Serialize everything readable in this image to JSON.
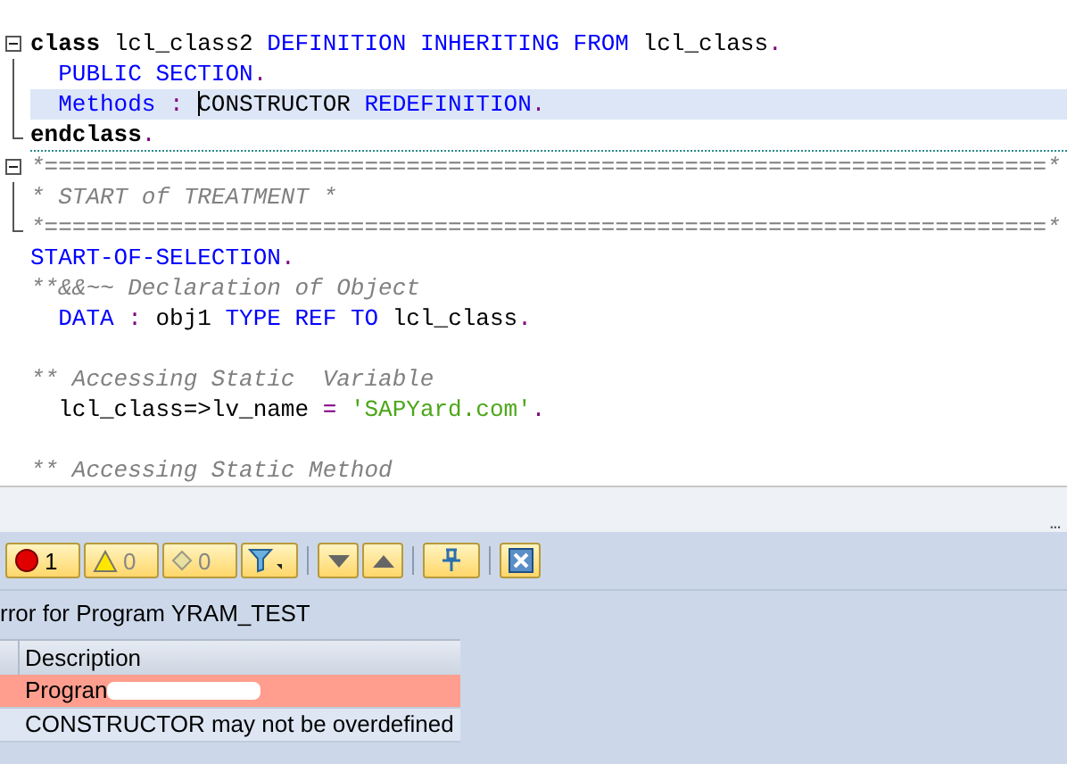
{
  "editor": {
    "lines": [
      {
        "kind": "fold_start",
        "highlighted": false,
        "separator_after": false,
        "tokens": [
          {
            "kind": "bold",
            "text": "class"
          },
          {
            "kind": "ident",
            "text": " lcl_class2 "
          },
          {
            "kind": "keyword",
            "text": "DEFINITION INHERITING FROM"
          },
          {
            "kind": "ident",
            "text": " lcl_class"
          },
          {
            "kind": "punct",
            "text": "."
          }
        ]
      },
      {
        "kind": "fold_body",
        "highlighted": false,
        "tokens": [
          {
            "kind": "keyword",
            "text": "  PUBLIC SECTION"
          },
          {
            "kind": "punct",
            "text": "."
          }
        ]
      },
      {
        "kind": "fold_body",
        "highlighted": true,
        "tokens": [
          {
            "kind": "keyword",
            "text": "  Methods "
          },
          {
            "kind": "punct",
            "text": ": "
          },
          {
            "kind": "ident",
            "text": "CONSTRUCTOR ",
            "caret": true
          },
          {
            "kind": "keyword",
            "text": "REDEFINITION"
          },
          {
            "kind": "punct",
            "text": "."
          }
        ]
      },
      {
        "kind": "fold_end",
        "highlighted": false,
        "separator_after": true,
        "tokens": [
          {
            "kind": "bold",
            "text": "endclass"
          },
          {
            "kind": "punct",
            "text": "."
          }
        ]
      },
      {
        "kind": "fold_start",
        "highlighted": false,
        "tokens": [
          {
            "kind": "comment",
            "text": "*========================================================================*"
          }
        ]
      },
      {
        "kind": "fold_body",
        "highlighted": false,
        "tokens": [
          {
            "kind": "comment",
            "text": "* START of TREATMENT *"
          }
        ]
      },
      {
        "kind": "fold_end",
        "highlighted": false,
        "tokens": [
          {
            "kind": "comment",
            "text": "*========================================================================*"
          }
        ]
      },
      {
        "kind": "plain",
        "highlighted": false,
        "tokens": [
          {
            "kind": "keyword",
            "text": "START-OF-SELECTION"
          },
          {
            "kind": "punct",
            "text": "."
          }
        ]
      },
      {
        "kind": "plain",
        "highlighted": false,
        "tokens": [
          {
            "kind": "comment",
            "text": "**&&~~ Declaration of Object"
          }
        ]
      },
      {
        "kind": "plain",
        "highlighted": false,
        "tokens": [
          {
            "kind": "keyword",
            "text": "  DATA "
          },
          {
            "kind": "punct",
            "text": ": "
          },
          {
            "kind": "ident",
            "text": "obj1 "
          },
          {
            "kind": "keyword",
            "text": "TYPE REF TO"
          },
          {
            "kind": "ident",
            "text": " lcl_class"
          },
          {
            "kind": "punct",
            "text": "."
          }
        ]
      },
      {
        "kind": "plain",
        "highlighted": false
      },
      {
        "kind": "plain",
        "highlighted": false,
        "tokens": [
          {
            "kind": "comment",
            "text": "** Accessing Static  Variable"
          }
        ]
      },
      {
        "kind": "plain",
        "highlighted": false,
        "tokens": [
          {
            "kind": "ident",
            "text": "  lcl_class=>lv_name "
          },
          {
            "kind": "punct",
            "text": "= "
          },
          {
            "kind": "string",
            "text": "'SAPYard.com'"
          },
          {
            "kind": "punct",
            "text": "."
          }
        ]
      },
      {
        "kind": "plain",
        "highlighted": false
      },
      {
        "kind": "plain",
        "highlighted": false,
        "tokens": [
          {
            "kind": "comment",
            "text": "** Accessing Static Method"
          }
        ]
      }
    ]
  },
  "splitter": {
    "grip": "..."
  },
  "toolbar": [
    {
      "kind": "error",
      "count": "1"
    },
    {
      "kind": "warning",
      "count": "0"
    },
    {
      "kind": "info",
      "count": "0"
    },
    {
      "kind": "filter"
    },
    {
      "kind": "sep"
    },
    {
      "kind": "down"
    },
    {
      "kind": "up"
    },
    {
      "kind": "sep"
    },
    {
      "kind": "pin"
    },
    {
      "kind": "sep"
    },
    {
      "kind": "close"
    }
  ],
  "messages": {
    "title": "rror for Program YRAM_TEST",
    "columns": [
      "Description"
    ],
    "rows": [
      {
        "kind": "error",
        "text": "Progran",
        "redacted": true
      },
      {
        "kind": "info",
        "text": "CONSTRUCTOR may not be overdefined",
        "redacted": false
      }
    ]
  }
}
